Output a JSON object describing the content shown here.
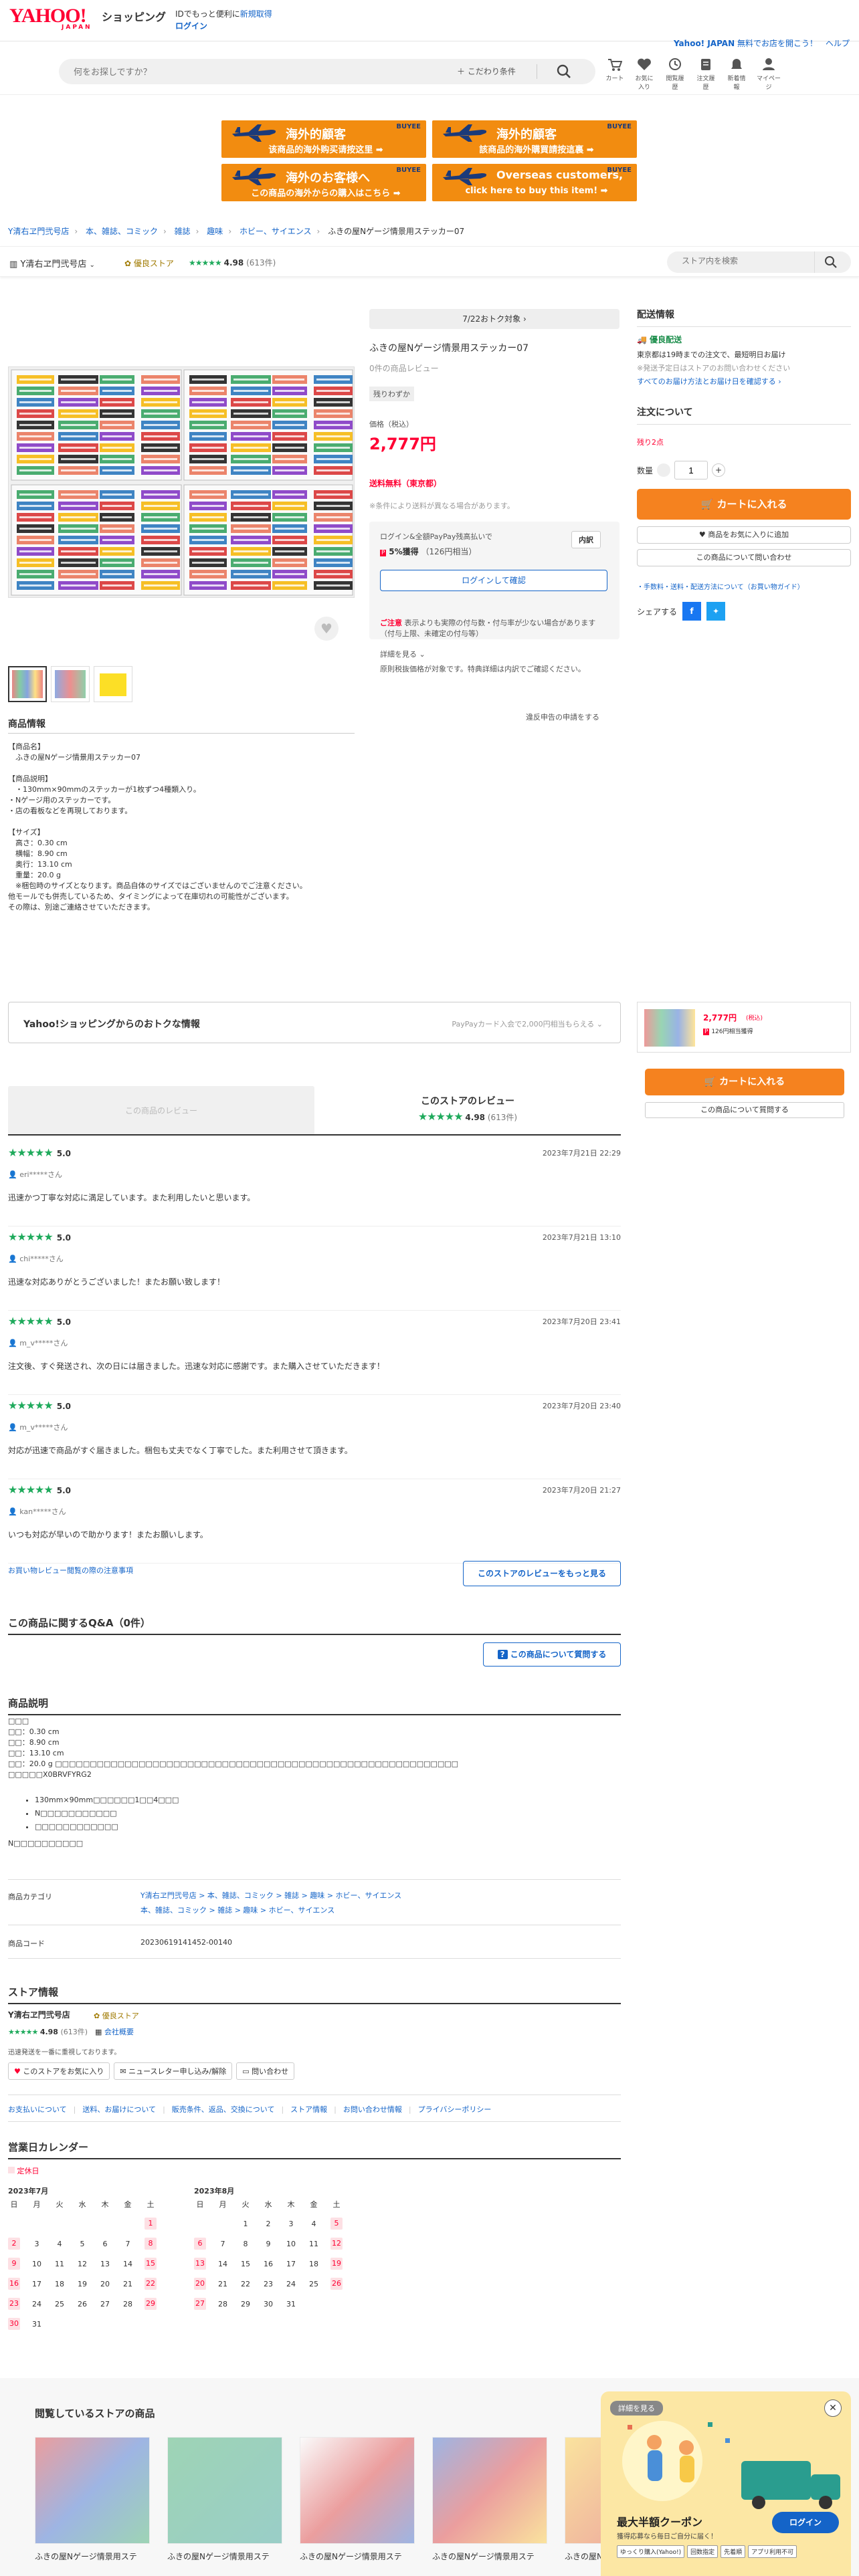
{
  "header": {
    "logo": "YAHOO!",
    "logo_sub": "JAPAN",
    "shopping": "ショッピング",
    "promo_prefix": "IDでもっと便利に",
    "promo_link": "新規取得",
    "login": "ログイン",
    "top_right_link": "Yahoo! JAPAN",
    "top_right_text": "無料でお店を開こう！",
    "help": "ヘルプ",
    "search_placeholder": "何をお探しですか？",
    "filter": "こだわり条件",
    "icons": [
      "カート",
      "お気に入り",
      "閲覧履歴",
      "注文履歴",
      "新着情報",
      "マイページ"
    ]
  },
  "banners": [
    {
      "title": "海外的顧客",
      "sub": "该商品的海外购买请按这里 ➡",
      "brand": "BUYEE"
    },
    {
      "title": "海外的顧客",
      "sub": "該商品的海外購買請按這裏 ➡",
      "brand": "BUYEE"
    },
    {
      "title": "海外のお客様へ",
      "sub": "この商品の海外からの購入はこちら ➡",
      "brand": "BUYEE"
    },
    {
      "title": "Overseas customers,",
      "sub": "click here to buy this item! ➡",
      "brand": "BUYEE"
    }
  ],
  "breadcrumb": [
    "Y清右ヱ門弐号店",
    "本、雑誌、コミック",
    "雑誌",
    "趣味",
    "ホビー、サイエンス",
    "ふきの屋Nゲージ情景用ステッカー07"
  ],
  "store": {
    "name": "Y清右ヱ門弐号店",
    "badge": "優良ストア",
    "rating": "4.98",
    "count": "(613件)",
    "search_placeholder": "ストア内を検索"
  },
  "product": {
    "deal": "7/22おトク対象 ›",
    "title": "ふきの屋Nゲージ情景用ステッカー07",
    "reviews": "0件の商品レビュー",
    "stock_badge": "残りわずか",
    "price_label": "価格（税込）",
    "price": "2,777円",
    "shipping": "送料無料（東京都）",
    "shipping_note": "※条件により送料が異なる場合があります。",
    "login_text": "ログイン&全額PayPay残高払いで",
    "points": "5%獲得",
    "points_sub": "（126円相当）",
    "breakdown": "内訳",
    "login_btn": "ログインして確認",
    "caution_label": "ご注意",
    "caution": "表示よりも実際の付与数・付与率が少ない場合があります（付与上限、未確定の付与等）",
    "detail": "詳細を見る ⌄",
    "caution2": "原則税抜価格が対象です。特典詳細は内訳でご確認ください。",
    "report": "違反申告の申請をする"
  },
  "delivery": {
    "title": "配送情報",
    "badge": "優良配送",
    "l1": "東京都は19時までの注文で、最短明日お届け",
    "l2": "※発送予定日はストアのお問い合わせください",
    "link": "すべてのお届け方法とお届け日を確認する ›"
  },
  "order": {
    "title": "注文について",
    "remain": "残り2点",
    "qty_label": "数量",
    "qty": "1",
    "cart": "カートに入れる",
    "fav": "商品をお気に入りに追加",
    "ask": "この商品について問い合わせ",
    "links": "・手数料・送料・配送方法について（お買い物ガイド）",
    "share": "シェアする"
  },
  "info": {
    "title": "商品情報",
    "lines": [
      "【商品名】",
      "　ふきの屋Nゲージ情景用ステッカー07",
      "",
      "【商品説明】",
      "　・130mm×90mmのステッカーが1枚ずつ4種類入り。",
      "・Nゲージ用のステッカーです。",
      "・店の看板などを再現しております。",
      "",
      "【サイズ】",
      "　高さ：0.30 cm",
      "　横幅：8.90 cm",
      "　奥行：13.10 cm",
      "　重量：20.0 g",
      "　※梱包時のサイズとなります。商品自体のサイズではございませんのでご注意ください。",
      "他モールでも併売しているため、タイミングによって在庫切れの可能性がございます。",
      "その際は、別途ご連絡させていただきます。"
    ]
  },
  "deals": {
    "title": "Yahoo!ショッピングからのおトクな情報",
    "right": "PayPayカード入会で2,000円相当もらえる ⌄"
  },
  "mini": {
    "price": "2,777円",
    "tax": "(税込)",
    "points": "126円相当獲得",
    "cart": "カートに入れる",
    "ask": "この商品について質問する"
  },
  "reviews": {
    "product_tab": "この商品のレビュー",
    "store_tab": "このストアのレビュー",
    "store_rating": "4.98",
    "store_count": "(613件)",
    "items": [
      {
        "score": "5.0",
        "date": "2023年7月21日 22:29",
        "user": "eri*****さん",
        "text": "迅速かつ丁寧な対応に満足しています。また利用したいと思います。"
      },
      {
        "score": "5.0",
        "date": "2023年7月21日 13:10",
        "user": "chi*****さん",
        "text": "迅速な対応ありがとうございました！またお願い致します！"
      },
      {
        "score": "5.0",
        "date": "2023年7月20日 23:41",
        "user": "m_v*****さん",
        "text": "注文後、すぐ発送され、次の日には届きました。迅速な対応に感謝です。また購入させていただきます！"
      },
      {
        "score": "5.0",
        "date": "2023年7月20日 23:40",
        "user": "m_v*****さん",
        "text": "対応が迅速で商品がすぐ届きました。梱包も丈夫でなく丁寧でした。また利用させて頂きます。"
      },
      {
        "score": "5.0",
        "date": "2023年7月20日 21:27",
        "user": "kan*****さん",
        "text": "いつも対応が早いので助かります！またお願いします。"
      }
    ],
    "guide": "お買い物レビュー閲覧の際の注意事項",
    "more": "このストアのレビューをもっと見る"
  },
  "qa": {
    "title": "この商品に関するQ&A（0件）",
    "btn": "この商品について質問する"
  },
  "desc": {
    "title": "商品説明",
    "lines": [
      "□□□",
      "□□：0.30 cm",
      "□□：8.90 cm",
      "□□：13.10 cm",
      "□□：20.0 g □□□□□□□□□□□□□□□□□□□□□□□□□□□□□□□□□□□□□□□□□□□□□□□□□□□□□□□□□□",
      "□□□□□X0BRVFYRG2"
    ],
    "bullets": [
      "130mm×90mm□□□□□□1□□4□□□",
      "N□□□□□□□□□□□",
      "□□□□□□□□□□□□"
    ],
    "footer": "N□□□□□□□□□□",
    "cat_label": "商品カテゴリ",
    "cat1": "Y清右ヱ門弐号店 > 本、雑誌、コミック > 雑誌 > 趣味 > ホビー、サイエンス",
    "cat2": "本、雑誌、コミック > 雑誌 > 趣味 > ホビー、サイエンス",
    "code_label": "商品コード",
    "code": "20230619141452-00140"
  },
  "storeinfo": {
    "title": "ストア情報",
    "name": "Y清右ヱ門弐号店",
    "badge": "優良ストア",
    "rating": "4.98",
    "count": "(613件)",
    "company": "会社概要",
    "note": "迅速発送を一番に重視しております。",
    "fav": "このストアをお気に入り",
    "news": "ニュースレター申し込み/解除",
    "contact": "問い合わせ",
    "links": [
      "お支払いについて",
      "送料、お届けについて",
      "販売条件、返品、交換について",
      "ストア情報",
      "お問い合わせ情報",
      "プライバシーポリシー"
    ]
  },
  "calendar": {
    "title": "営業日カレンダー",
    "legend": "定休日",
    "m1": "2023年7月",
    "m2": "2023年8月",
    "dow": [
      "日",
      "月",
      "火",
      "水",
      "木",
      "金",
      "土"
    ],
    "w1": [
      [
        "",
        "",
        "",
        "",
        "",
        "",
        "1"
      ],
      [
        "2",
        "3",
        "4",
        "5",
        "6",
        "7",
        "8"
      ],
      [
        "9",
        "10",
        "11",
        "12",
        "13",
        "14",
        "15"
      ],
      [
        "16",
        "17",
        "18",
        "19",
        "20",
        "21",
        "22"
      ],
      [
        "23",
        "24",
        "25",
        "26",
        "27",
        "28",
        "29"
      ],
      [
        "30",
        "31",
        "",
        "",
        "",
        "",
        ""
      ]
    ],
    "w2": [
      [
        "",
        "",
        "1",
        "2",
        "3",
        "4",
        "5"
      ],
      [
        "6",
        "7",
        "8",
        "9",
        "10",
        "11",
        "12"
      ],
      [
        "13",
        "14",
        "15",
        "16",
        "17",
        "18",
        "19"
      ],
      [
        "20",
        "21",
        "22",
        "23",
        "24",
        "25",
        "26"
      ],
      [
        "27",
        "28",
        "29",
        "30",
        "31",
        "",
        ""
      ]
    ]
  },
  "recent": {
    "title": "閲覧しているストアの商品",
    "items": [
      "ふきの屋Nゲージ情景用ステ",
      "ふきの屋Nゲージ情景用ステ",
      "ふきの屋Nゲージ情景用ステ",
      "ふきの屋Nゲージ情景用ステ",
      "ふきの屋Nゲージ情景用ステ"
    ]
  },
  "coupon": {
    "detail": "詳細を見る",
    "title": "最大半額クーポン",
    "sub": "獲得応募なら毎日ご自分に届く！",
    "login": "ログイン",
    "tags": [
      "ゆっくり購入(Yahoo!)",
      "回数指定",
      "先着順",
      "アプリ利用不可"
    ]
  }
}
